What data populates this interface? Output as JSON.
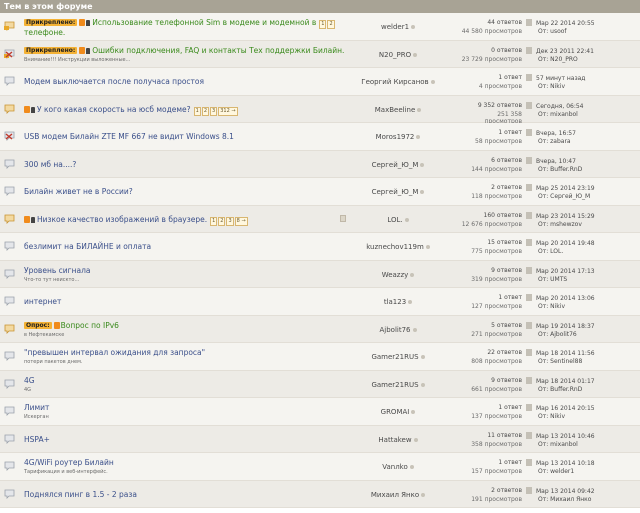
{
  "header": {
    "title": "Тем в этом форуме"
  },
  "colors": {
    "header_bg": "#a8a395",
    "prefix_bg": "#f4b235",
    "link_green": "#3a8a1c",
    "link_blue": "#3a4f8a",
    "pagenav_bg": "#fff7de"
  },
  "topics": [
    {
      "prefix": "Прикреплено:",
      "title": "Использование телефонной Sim в модеме и модемной в телефоне.",
      "title_line1": "Использование телефонной Sim в модеме и модемной в",
      "title_line2": "телефоне.",
      "pages": [
        "1",
        "2"
      ],
      "snippet": "",
      "author": "welder1",
      "replies": "44 ответов",
      "views": "44 580 просмотров",
      "last_time": "Мар 22 2014 20:55",
      "last_by": "От: usoof",
      "icon": "sticky-hot-icon"
    },
    {
      "prefix": "Прикреплено:",
      "title": "Ошибки подключения, FAQ и контакты Тех поддержки Билайн.",
      "snippet": "Внимание!!! Инструкции выложенные...",
      "author": "N20_PRO",
      "replies": "0 ответов",
      "views": "23 729 просмотров",
      "last_time": "Дек 23 2011 22:41",
      "last_by": "От: N20_PRO",
      "icon": "sticky-locked-icon"
    },
    {
      "prefix": "",
      "title": "Модем выключается после получаса простоя",
      "snippet": "",
      "author": "Георгий Кирсанов",
      "replies": "1 ответ",
      "views": "4 просмотров",
      "last_time": "57 минут назад",
      "last_by": "От: Nikiv",
      "icon": "topic-icon"
    },
    {
      "prefix": "",
      "title": "У кого какая скорость на юсб модеме?",
      "pages": [
        "1",
        "2",
        "3",
        "312 →"
      ],
      "snippet": "",
      "author": "MaxBeeline",
      "replies": "9 352 ответов",
      "views": "251 358 просмотров",
      "last_time": "Сегодня, 06:54",
      "last_by": "От: mixanbol",
      "icon": "hot-topic-icon"
    },
    {
      "prefix": "",
      "title": "USB модем Билайн ZTE MF 667 не видит Windows 8.1",
      "snippet": "",
      "author": "Moros1972",
      "replies": "1 ответ",
      "views": "58 просмотров",
      "last_time": "Вчера, 16:57",
      "last_by": "От: zabara",
      "icon": "locked-topic-icon"
    },
    {
      "prefix": "",
      "title": "300 мб на....?",
      "snippet": "",
      "author": "Сергей_Ю_М",
      "replies": "6 ответов",
      "views": "144 просмотров",
      "last_time": "Вчера, 10:47",
      "last_by": "От: Buffer.RnD",
      "icon": "topic-icon"
    },
    {
      "prefix": "",
      "title": "Билайн живет не в России?",
      "snippet": "",
      "author": "Сергей_Ю_М",
      "replies": "2 ответов",
      "views": "118 просмотров",
      "last_time": "Мар 25 2014 23:19",
      "last_by": "От: Сергей_Ю_М",
      "icon": "topic-icon"
    },
    {
      "prefix": "",
      "title": "Низкое качество изображений в браузере.",
      "pages": [
        "1",
        "2",
        "3",
        "8 →"
      ],
      "snippet": "",
      "author": "LOL.",
      "replies": "160 ответов",
      "views": "12 676 просмотров",
      "last_time": "Мар 23 2014 15:29",
      "last_by": "От: mshewzov",
      "icon": "hot-topic-icon"
    },
    {
      "prefix": "",
      "title": "безлимит на БИЛАЙНЕ и оплата",
      "snippet": "",
      "author": "kuznechov119m",
      "replies": "15 ответов",
      "views": "775 просмотров",
      "last_time": "Мар 20 2014 19:48",
      "last_by": "От: LOL.",
      "icon": "topic-icon"
    },
    {
      "prefix": "",
      "title": "Уровень сигнала",
      "snippet": "Что-то тут неискто...",
      "author": "Weazzy",
      "replies": "9 ответов",
      "views": "319 просмотров",
      "last_time": "Мар 20 2014 17:13",
      "last_by": "От: UMTS",
      "icon": "topic-icon"
    },
    {
      "prefix": "",
      "title": "интернет",
      "snippet": "",
      "author": "tla123",
      "replies": "1 ответ",
      "views": "127 просмотров",
      "last_time": "Мар 20 2014 13:06",
      "last_by": "От: Nikiv",
      "icon": "topic-icon"
    },
    {
      "prefix": "Опрос:",
      "title": "Вопрос по IPv6",
      "snippet": "в Нефтекамске",
      "author": "Ajbolit76",
      "replies": "5 ответов",
      "views": "271 просмотров",
      "last_time": "Мар 19 2014 18:37",
      "last_by": "От: Ajbolit76",
      "icon": "poll-icon"
    },
    {
      "prefix": "",
      "title": "\"превышен интервал ожидания для запроса\"",
      "snippet": "потери пакетов днем.",
      "author": "Gamer21RUS",
      "replies": "22 ответов",
      "views": "808 просмотров",
      "last_time": "Мар 18 2014 11:56",
      "last_by": "От: Sentinel88",
      "icon": "topic-icon"
    },
    {
      "prefix": "",
      "title": "4G",
      "snippet": "4G",
      "author": "Gamer21RUS",
      "replies": "9 ответов",
      "views": "661 просмотров",
      "last_time": "Мар 18 2014 01:17",
      "last_by": "От: Buffer.RnD",
      "icon": "topic-icon"
    },
    {
      "prefix": "",
      "title": "Лимит",
      "snippet": "Искерган",
      "author": "GROMAI",
      "replies": "1 ответ",
      "views": "137 просмотров",
      "last_time": "Мар 16 2014 20:15",
      "last_by": "От: Nikiv",
      "icon": "topic-icon"
    },
    {
      "prefix": "",
      "title": "HSPA+",
      "snippet": "",
      "author": "Hattakew",
      "replies": "11 ответов",
      "views": "358 просмотров",
      "last_time": "Мар 13 2014 10:46",
      "last_by": "От: mixanbol",
      "icon": "topic-icon"
    },
    {
      "prefix": "",
      "title": "4G/WiFi роутер Билайн",
      "snippet": "Тарификация и веб-интерфейс.",
      "author": "Vanлko",
      "replies": "1 ответ",
      "views": "157 просмотров",
      "last_time": "Мар 13 2014 10:18",
      "last_by": "От: welder1",
      "icon": "topic-icon"
    },
    {
      "prefix": "",
      "title": "Поднялся пинг в 1.5 - 2 раза",
      "snippet": "",
      "author": "Михаил Янко",
      "replies": "2 ответов",
      "views": "191 просмотров",
      "last_time": "Мар 13 2014 09:42",
      "last_by": "От: Михаил Янко",
      "icon": "topic-icon"
    }
  ]
}
